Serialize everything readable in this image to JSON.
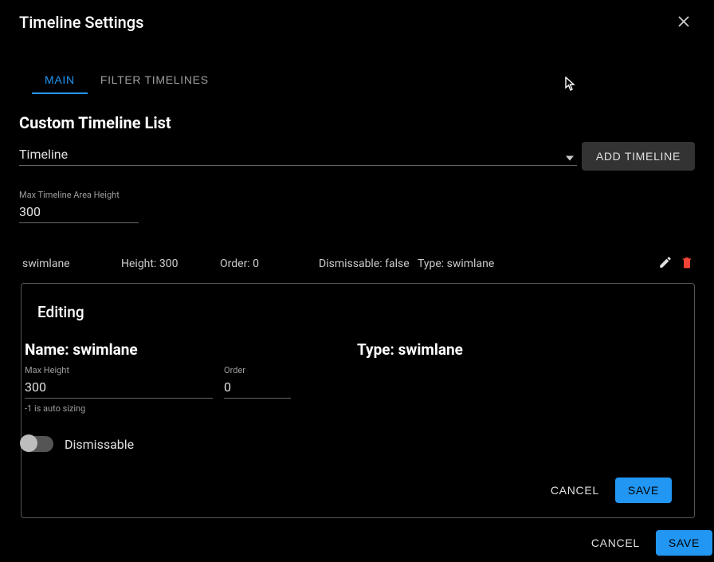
{
  "header": {
    "title": "Timeline Settings"
  },
  "tabs": {
    "main": "MAIN",
    "filter": "FILTER TIMELINES"
  },
  "main": {
    "section_title": "Custom Timeline List",
    "select_label": "Timeline",
    "add_timeline": "ADD TIMELINE",
    "max_height_label": "Max Timeline Area Height",
    "max_height_value": "300"
  },
  "row": {
    "name": "swimlane",
    "height": "Height: 300",
    "order": "Order: 0",
    "dismissable": "Dismissable: false",
    "type": "Type: swimlane"
  },
  "edit": {
    "title": "Editing",
    "name_label": "Name: swimlane",
    "type_label": "Type: swimlane",
    "max_height_label": "Max Height",
    "max_height_value": "300",
    "max_height_helper": "-1 is auto sizing",
    "order_label": "Order",
    "order_value": "0",
    "dismissable_label": "Dismissable",
    "cancel": "CANCEL",
    "save": "SAVE"
  },
  "dialog": {
    "cancel": "CANCEL",
    "save": "SAVE"
  },
  "colors": {
    "primary": "#2196f3",
    "danger": "#f44336"
  }
}
